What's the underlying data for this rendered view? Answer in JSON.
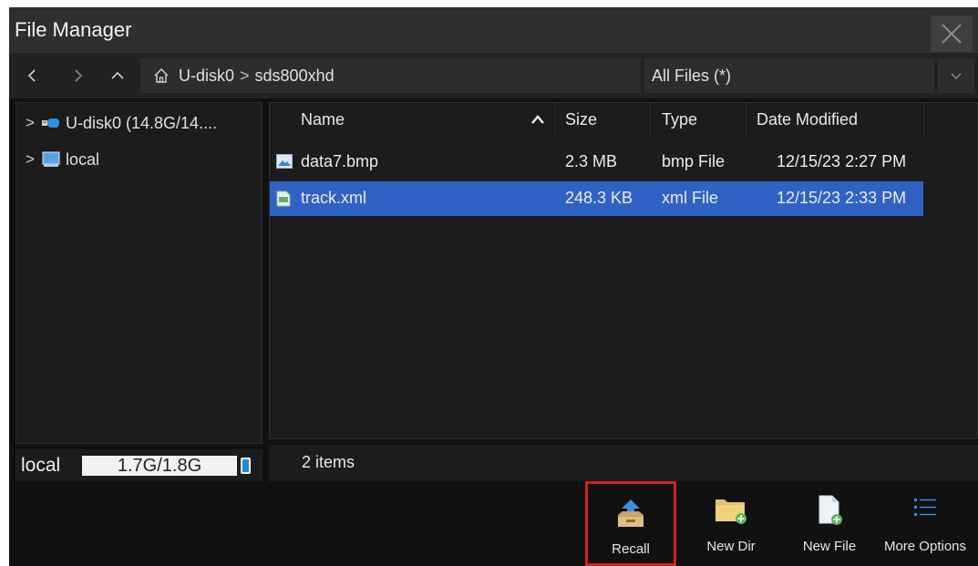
{
  "window": {
    "title": "File Manager",
    "close_icon": "close-icon"
  },
  "nav": {
    "back_icon": "chevron-left-icon",
    "forward_icon": "chevron-right-icon",
    "up_icon": "chevron-up-icon",
    "home_icon": "home-icon",
    "path": [
      "U-disk0",
      "sds800xhd"
    ],
    "path_separator": ">",
    "filter": {
      "selected": "All Files (*)"
    }
  },
  "tree": {
    "items": [
      {
        "label": "U-disk0  (14.8G/14....",
        "icon": "usb-drive-icon",
        "expander": ">"
      },
      {
        "label": "local",
        "icon": "computer-icon",
        "expander": ">"
      }
    ]
  },
  "storage": {
    "name": "local",
    "usage": "1.7G/1.8G"
  },
  "table": {
    "columns": [
      "Name",
      "Size",
      "Type",
      "Date Modified"
    ],
    "sort_column": "Name",
    "sort_direction": "ascending",
    "rows": [
      {
        "name": "data7.bmp",
        "size": "2.3 MB",
        "type": "bmp File",
        "date": "12/15/23 2:27 PM",
        "icon": "image-file-icon",
        "selected": false
      },
      {
        "name": "track.xml",
        "size": "248.3 KB",
        "type": "xml File",
        "date": "12/15/23 2:33 PM",
        "icon": "xml-file-icon",
        "selected": true
      }
    ]
  },
  "status": {
    "count": "2 items"
  },
  "toolbar": {
    "buttons": [
      {
        "label": "Recall",
        "icon": "recall-icon",
        "highlighted": true
      },
      {
        "label": "New Dir",
        "icon": "new-folder-icon",
        "highlighted": false
      },
      {
        "label": "New File",
        "icon": "new-file-icon",
        "highlighted": false
      },
      {
        "label": "More Options",
        "icon": "list-icon",
        "highlighted": false
      }
    ]
  },
  "colors": {
    "selection": "#2f62c4",
    "highlight_border": "#d61f1f",
    "accent": "#1e8ad6"
  }
}
